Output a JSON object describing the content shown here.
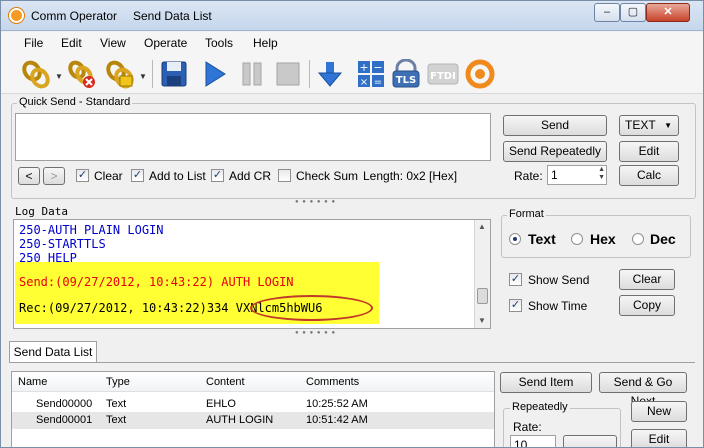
{
  "titlebar": {
    "app_title": "Comm Operator",
    "doc_title": "Send Data List",
    "minimize": "–",
    "maximize": "▢",
    "close": "✕"
  },
  "menu": [
    "File",
    "Edit",
    "View",
    "Operate",
    "Tools",
    "Help"
  ],
  "toolbar": {
    "icons": [
      "connect-chain-icon",
      "disconnect-chain-icon",
      "open-chain-icon",
      "save-icon",
      "play-icon",
      "pause-icon",
      "stop-icon",
      "download-arrow-icon",
      "calculator-icon",
      "tls-icon",
      "ftdi-icon",
      "app-logo-icon"
    ],
    "tls_label": "TLS",
    "ftdi_label": "FTDI"
  },
  "quick_send": {
    "title": "Quick Send - Standard",
    "input_value": "",
    "send_button": "Send",
    "send_repeatedly_button": "Send Repeatedly",
    "format_select": "TEXT",
    "edit_button": "Edit",
    "calc_button": "Calc",
    "rate_label": "Rate:",
    "rate_value": "1",
    "nav_prev": "<",
    "nav_next": ">",
    "options": [
      {
        "label": "Clear",
        "checked": true
      },
      {
        "label": "Add to List",
        "checked": true
      },
      {
        "label": "Add CR",
        "checked": true
      },
      {
        "label": "Check Sum",
        "checked": false
      }
    ],
    "length_text": "Length: 0x2 [Hex]"
  },
  "log": {
    "title": "Log Data",
    "lines": [
      "250-AUTH PLAIN LOGIN",
      "250-STARTTLS",
      "250 HELP"
    ],
    "send_line": "Send:(09/27/2012, 10:43:22) AUTH LOGIN",
    "rec_prefix": "Rec:(09/27/2012, 10:43:22)334 ",
    "rec_highlight": "VXNlcm5hbWU6",
    "colors": {
      "blue_text": "#0000cc",
      "red_text": "#e8000b",
      "highlight": "#ffff33",
      "ellipse": "#c0392b"
    }
  },
  "format_panel": {
    "title": "Format",
    "options": [
      {
        "label": "Text",
        "selected": true
      },
      {
        "label": "Hex",
        "selected": false
      },
      {
        "label": "Dec",
        "selected": false
      }
    ],
    "show_send_label": "Show Send",
    "show_send_checked": true,
    "show_time_label": "Show Time",
    "show_time_checked": true,
    "clear_button": "Clear",
    "copy_button": "Copy"
  },
  "send_list": {
    "tab": "Send Data List",
    "columns": [
      "Name",
      "Type",
      "Content",
      "Comments"
    ],
    "rows": [
      {
        "name": "Send00000",
        "type": "Text",
        "content": "EHLO",
        "comments": "10:25:52 AM"
      },
      {
        "name": "Send00001",
        "type": "Text",
        "content": "AUTH LOGIN",
        "comments": "10:51:42 AM"
      }
    ],
    "send_item_button": "Send Item",
    "send_go_next_button": "Send & Go Next",
    "repeatedly_title": "Repeatedly",
    "rate_label": "Rate:",
    "rate_value": "10",
    "new_button": "New",
    "edit_button": "Edit"
  }
}
